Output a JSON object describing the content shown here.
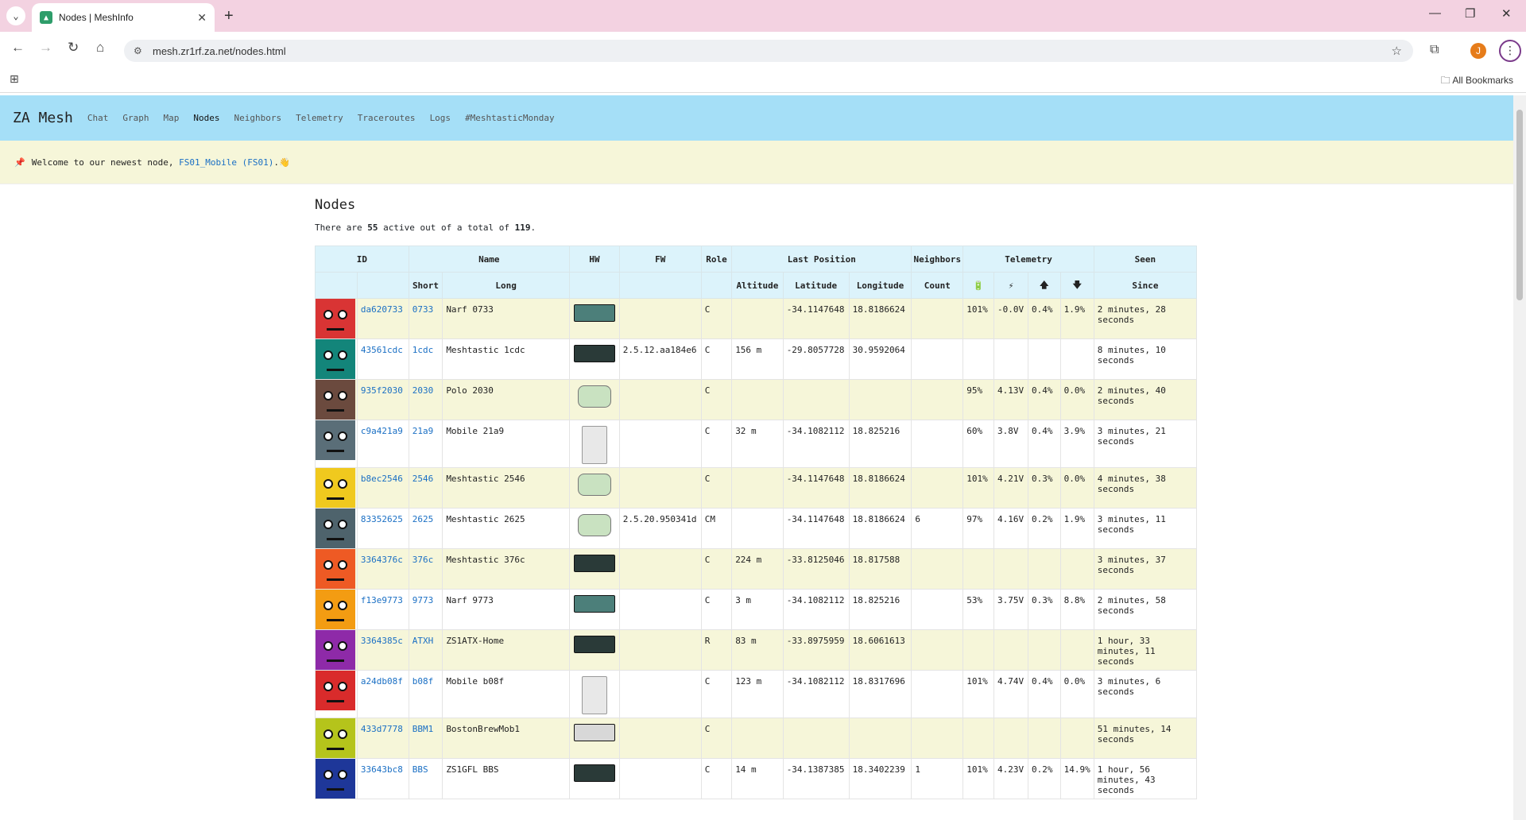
{
  "browser": {
    "tab_title": "Nodes | MeshInfo",
    "url": "mesh.zr1rf.za.net/nodes.html",
    "profile_initial": "J",
    "bookmarks_label": "All Bookmarks"
  },
  "site": {
    "brand": "ZA Mesh",
    "nav": [
      "Chat",
      "Graph",
      "Map",
      "Nodes",
      "Neighbors",
      "Telemetry",
      "Traceroutes",
      "Logs",
      "#MeshtasticMonday"
    ],
    "announcement": {
      "prefix": "Welcome to our newest node, ",
      "link": "FS01_Mobile (FS01)",
      "suffix": ".👋"
    }
  },
  "page": {
    "title": "Nodes",
    "summary_pre": "There are ",
    "active": "55",
    "summary_mid": " active out of a total of ",
    "total": "119",
    "summary_post": "."
  },
  "table": {
    "group_headers": [
      "ID",
      "Name",
      "HW",
      "FW",
      "Role",
      "Last Position",
      "Neighbors",
      "Telemetry",
      "Seen"
    ],
    "sub_headers": [
      "Short",
      "Long",
      "Altitude",
      "Latitude",
      "Longitude",
      "Count",
      "🔋",
      "⚡",
      "🡅",
      "🡇",
      "Since"
    ],
    "rows": [
      {
        "id": "da620733",
        "short": "0733",
        "long": "Narf 0733",
        "fw": "",
        "role": "C",
        "alt": "",
        "lat": "-34.1147648",
        "lon": "18.8186624",
        "nb": "",
        "bat": "101%",
        "volt": "-0.0V",
        "up": "0.4%",
        "down": "1.9%",
        "seen": "2 minutes, 28 seconds",
        "color": "#d93434",
        "hw": "board"
      },
      {
        "id": "43561cdc",
        "short": "1cdc",
        "long": "Meshtastic 1cdc",
        "fw": "2.5.12.aa184e6",
        "role": "C",
        "alt": "156 m",
        "lat": "-29.8057728",
        "lon": "30.9592064",
        "nb": "",
        "bat": "",
        "volt": "",
        "up": "",
        "down": "",
        "seen": "8 minutes, 10 seconds",
        "color": "#13857a",
        "hw": "dark"
      },
      {
        "id": "935f2030",
        "short": "2030",
        "long": "Polo 2030",
        "fw": "",
        "role": "C",
        "alt": "",
        "lat": "",
        "lon": "",
        "nb": "",
        "bat": "95%",
        "volt": "4.13V",
        "up": "0.4%",
        "down": "0.0%",
        "seen": "2 minutes, 40 seconds",
        "color": "#6b4a3e",
        "hw": "ant"
      },
      {
        "id": "c9a421a9",
        "short": "21a9",
        "long": "Mobile 21a9",
        "fw": "",
        "role": "C",
        "alt": "32 m",
        "lat": "-34.1082112",
        "lon": "18.825216",
        "nb": "",
        "bat": "60%",
        "volt": "3.8V",
        "up": "0.4%",
        "down": "3.9%",
        "seen": "3 minutes, 21 seconds",
        "color": "#5a6e78",
        "hw": "tall"
      },
      {
        "id": "b8ec2546",
        "short": "2546",
        "long": "Meshtastic 2546",
        "fw": "",
        "role": "C",
        "alt": "",
        "lat": "-34.1147648",
        "lon": "18.8186624",
        "nb": "",
        "bat": "101%",
        "volt": "4.21V",
        "up": "0.3%",
        "down": "0.0%",
        "seen": "4 minutes, 38 seconds",
        "color": "#f0c91e",
        "hw": "ant"
      },
      {
        "id": "83352625",
        "short": "2625",
        "long": "Meshtastic 2625",
        "fw": "2.5.20.950341d",
        "role": "CM",
        "alt": "",
        "lat": "-34.1147648",
        "lon": "18.8186624",
        "nb": "6",
        "bat": "97%",
        "volt": "4.16V",
        "up": "0.2%",
        "down": "1.9%",
        "seen": "3 minutes, 11 seconds",
        "color": "#4e636c",
        "hw": "ant"
      },
      {
        "id": "3364376c",
        "short": "376c",
        "long": "Meshtastic 376c",
        "fw": "",
        "role": "C",
        "alt": "224 m",
        "lat": "-33.8125046",
        "lon": "18.817588",
        "nb": "",
        "bat": "",
        "volt": "",
        "up": "",
        "down": "",
        "seen": "3 minutes, 37 seconds",
        "color": "#ee5a24",
        "hw": "dark"
      },
      {
        "id": "f13e9773",
        "short": "9773",
        "long": "Narf 9773",
        "fw": "",
        "role": "C",
        "alt": "3 m",
        "lat": "-34.1082112",
        "lon": "18.825216",
        "nb": "",
        "bat": "53%",
        "volt": "3.75V",
        "up": "0.3%",
        "down": "8.8%",
        "seen": "2 minutes, 58 seconds",
        "color": "#f39c12",
        "hw": "board"
      },
      {
        "id": "3364385c",
        "short": "ATXH",
        "long": "ZS1ATX-Home",
        "fw": "",
        "role": "R",
        "alt": "83 m",
        "lat": "-33.8975959",
        "lon": "18.6061613",
        "nb": "",
        "bat": "",
        "volt": "",
        "up": "",
        "down": "",
        "seen": "1 hour, 33 minutes, 11 seconds",
        "color": "#8e2aa8",
        "hw": "dark"
      },
      {
        "id": "a24db08f",
        "short": "b08f",
        "long": "Mobile b08f",
        "fw": "",
        "role": "C",
        "alt": "123 m",
        "lat": "-34.1082112",
        "lon": "18.8317696",
        "nb": "",
        "bat": "101%",
        "volt": "4.74V",
        "up": "0.4%",
        "down": "0.0%",
        "seen": "3 minutes, 6 seconds",
        "color": "#d92b2b",
        "hw": "tall"
      },
      {
        "id": "433d7778",
        "short": "BBM1",
        "long": "BostonBrewMob1",
        "fw": "",
        "role": "C",
        "alt": "",
        "lat": "",
        "lon": "",
        "nb": "",
        "bat": "",
        "volt": "",
        "up": "",
        "down": "",
        "seen": "51 minutes, 14 seconds",
        "color": "#b5c41b",
        "hw": "white"
      },
      {
        "id": "33643bc8",
        "short": "BBS",
        "long": "ZS1GFL BBS",
        "fw": "",
        "role": "C",
        "alt": "14 m",
        "lat": "-34.1387385",
        "lon": "18.3402239",
        "nb": "1",
        "bat": "101%",
        "volt": "4.23V",
        "up": "0.2%",
        "down": "14.9%",
        "seen": "1 hour, 56 minutes, 43 seconds",
        "color": "#1e3799",
        "hw": "dark"
      }
    ]
  }
}
